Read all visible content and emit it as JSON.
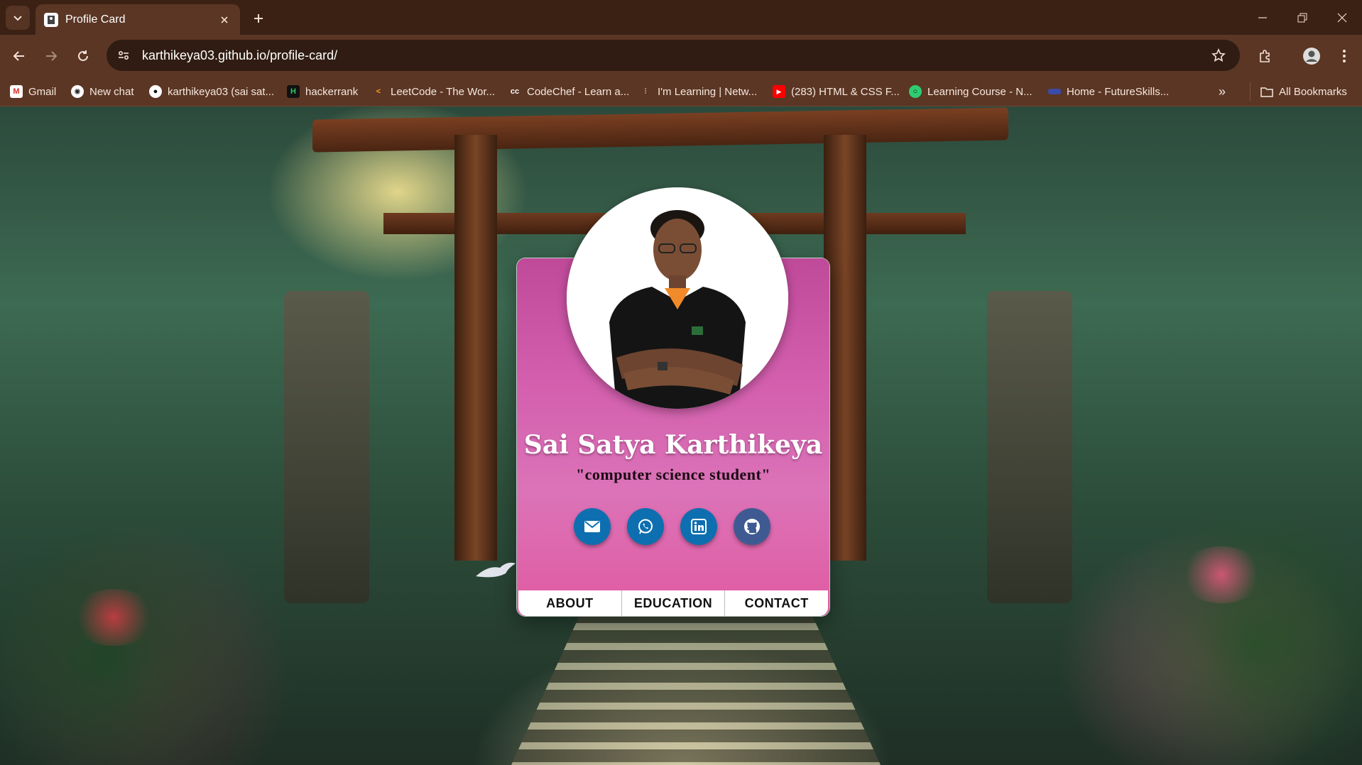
{
  "browser": {
    "tab_title": "Profile Card",
    "url": "karthikeya03.github.io/profile-card/",
    "bookmarks": [
      {
        "label": "Gmail",
        "icon": "gmail-icon"
      },
      {
        "label": "New chat",
        "icon": "chatgpt-icon"
      },
      {
        "label": "karthikeya03 (sai sat...",
        "icon": "github-icon"
      },
      {
        "label": "hackerrank",
        "icon": "hackerrank-icon"
      },
      {
        "label": "LeetCode - The Wor...",
        "icon": "leetcode-icon"
      },
      {
        "label": "CodeChef - Learn a...",
        "icon": "codechef-icon"
      },
      {
        "label": "I'm Learning | Netw...",
        "icon": "cisco-icon"
      },
      {
        "label": "(283) HTML & CSS F...",
        "icon": "youtube-icon"
      },
      {
        "label": "Learning Course - N...",
        "icon": "course-icon"
      },
      {
        "label": "Home - FutureSkills...",
        "icon": "futureskills-icon"
      }
    ],
    "all_bookmarks_label": "All Bookmarks"
  },
  "profile": {
    "name": "Sai Satya Karthikeya",
    "tagline": "\"computer science student\"",
    "socials": [
      "email-icon",
      "whatsapp-icon",
      "linkedin-icon",
      "github-icon"
    ],
    "nav": [
      "ABOUT",
      "EDUCATION",
      "CONTACT"
    ]
  },
  "colors": {
    "card_top": "#c04a9a",
    "card_bottom": "#e05aa0",
    "social_button": "#0e6fb0",
    "github_button": "#3f5a92"
  }
}
